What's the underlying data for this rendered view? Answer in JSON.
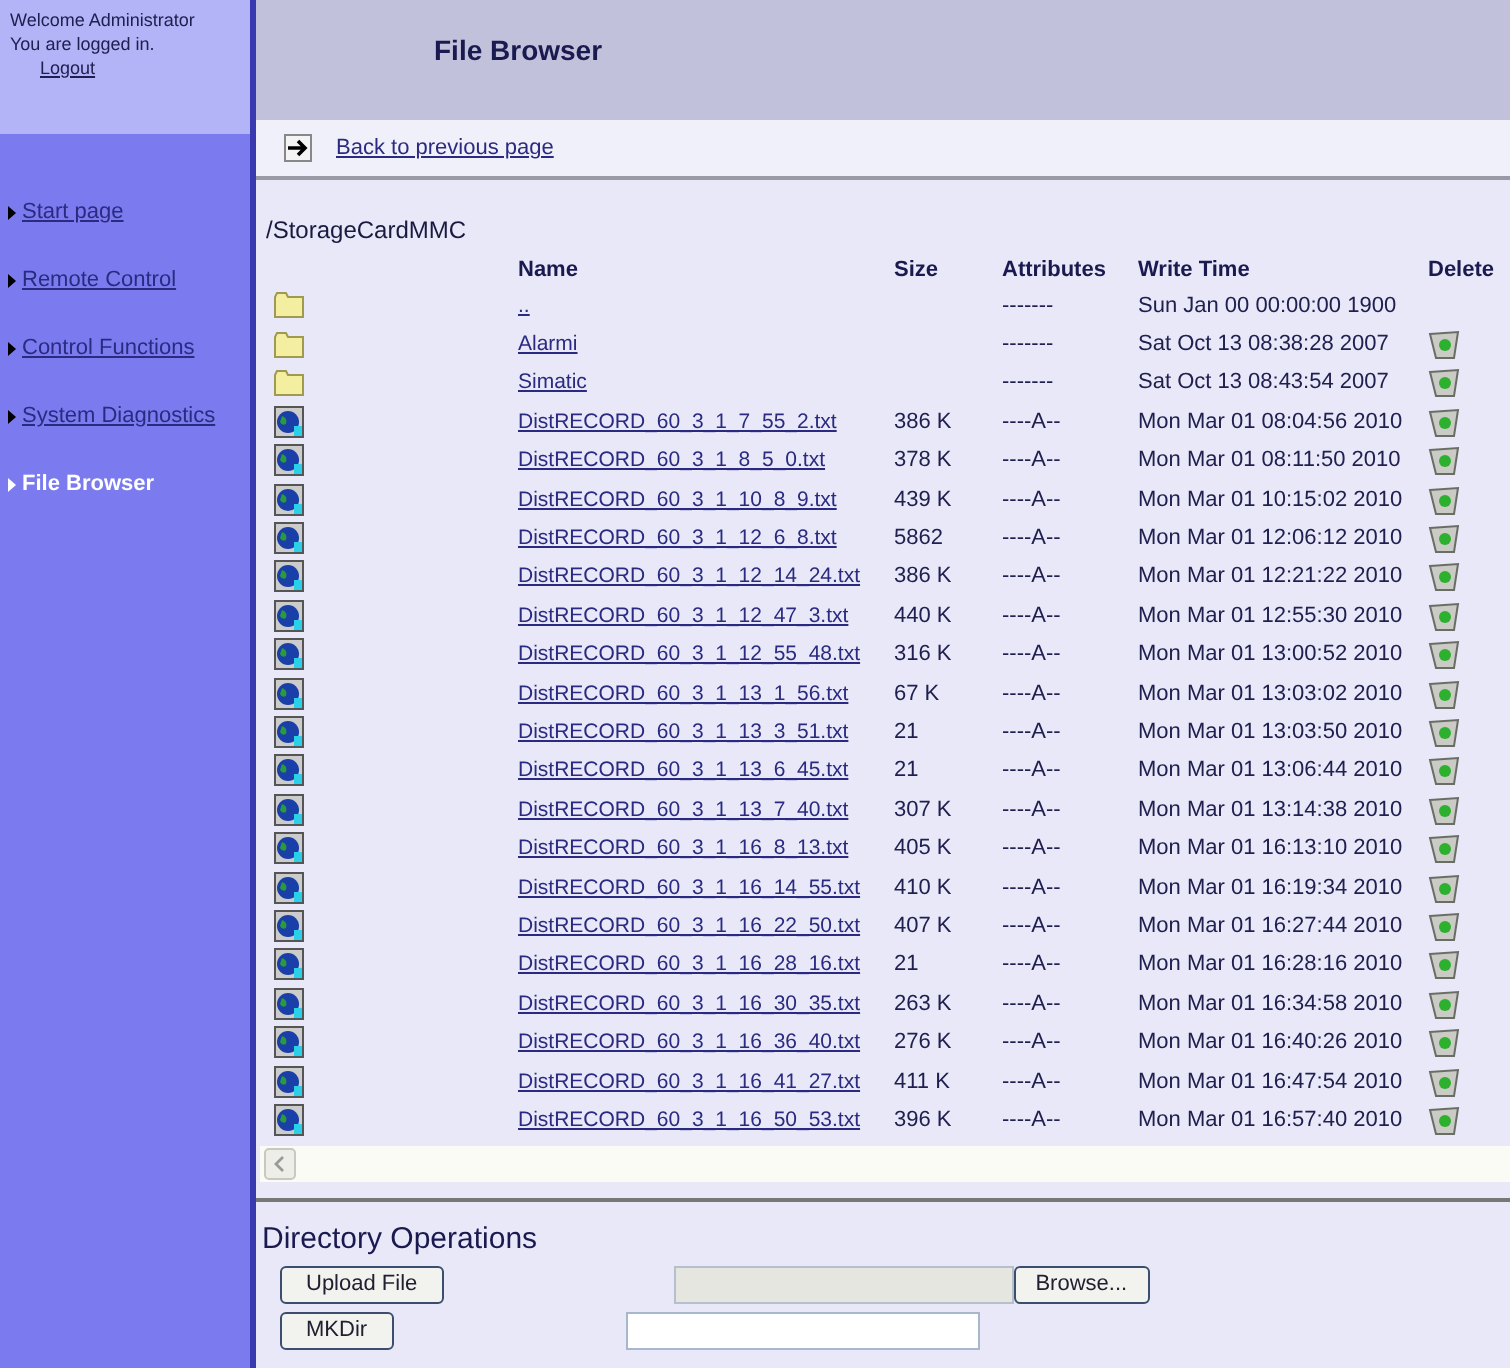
{
  "sidebar": {
    "welcome": [
      "Welcome Administrator",
      "You are logged in."
    ],
    "logout": "Logout",
    "items": [
      {
        "label": "Start page",
        "selected": false
      },
      {
        "label": "Remote Control",
        "selected": false
      },
      {
        "label": "Control Functions",
        "selected": false
      },
      {
        "label": "System Diagnostics",
        "selected": false
      },
      {
        "label": "File Browser",
        "selected": true
      }
    ]
  },
  "header": {
    "title": "File Browser"
  },
  "back_link": "Back to previous page",
  "path": "/StorageCardMMC",
  "table": {
    "columns": [
      "Name",
      "Size",
      "Attributes",
      "Write Time",
      "Delete"
    ],
    "rows": [
      {
        "kind": "folder",
        "name": "..",
        "size": "",
        "attributes": "-------",
        "time": "Sun Jan 00 00:00:00 1900",
        "deletable": false
      },
      {
        "kind": "folder",
        "name": "Alarmi",
        "size": "",
        "attributes": "-------",
        "time": "Sat Oct 13 08:38:28 2007",
        "deletable": true
      },
      {
        "kind": "folder",
        "name": "Simatic",
        "size": "",
        "attributes": "-------",
        "time": "Sat Oct 13 08:43:54 2007",
        "deletable": true
      },
      {
        "kind": "file",
        "name": "DistRECORD_60_3_1_7_55_2.txt",
        "size": "386 K",
        "attributes": "----A--",
        "time": "Mon Mar 01 08:04:56 2010",
        "deletable": true
      },
      {
        "kind": "file",
        "name": "DistRECORD_60_3_1_8_5_0.txt",
        "size": "378 K",
        "attributes": "----A--",
        "time": "Mon Mar 01 08:11:50 2010",
        "deletable": true
      },
      {
        "kind": "file",
        "name": "DistRECORD_60_3_1_10_8_9.txt",
        "size": "439 K",
        "attributes": "----A--",
        "time": "Mon Mar 01 10:15:02 2010",
        "deletable": true
      },
      {
        "kind": "file",
        "name": "DistRECORD_60_3_1_12_6_8.txt",
        "size": "5862",
        "attributes": "----A--",
        "time": "Mon Mar 01 12:06:12 2010",
        "deletable": true
      },
      {
        "kind": "file",
        "name": "DistRECORD_60_3_1_12_14_24.txt",
        "size": "386 K",
        "attributes": "----A--",
        "time": "Mon Mar 01 12:21:22 2010",
        "deletable": true
      },
      {
        "kind": "file",
        "name": "DistRECORD_60_3_1_12_47_3.txt",
        "size": "440 K",
        "attributes": "----A--",
        "time": "Mon Mar 01 12:55:30 2010",
        "deletable": true
      },
      {
        "kind": "file",
        "name": "DistRECORD_60_3_1_12_55_48.txt",
        "size": "316 K",
        "attributes": "----A--",
        "time": "Mon Mar 01 13:00:52 2010",
        "deletable": true
      },
      {
        "kind": "file",
        "name": "DistRECORD_60_3_1_13_1_56.txt",
        "size": "67 K",
        "attributes": "----A--",
        "time": "Mon Mar 01 13:03:02 2010",
        "deletable": true
      },
      {
        "kind": "file",
        "name": "DistRECORD_60_3_1_13_3_51.txt",
        "size": "21",
        "attributes": "----A--",
        "time": "Mon Mar 01 13:03:50 2010",
        "deletable": true
      },
      {
        "kind": "file",
        "name": "DistRECORD_60_3_1_13_6_45.txt",
        "size": "21",
        "attributes": "----A--",
        "time": "Mon Mar 01 13:06:44 2010",
        "deletable": true
      },
      {
        "kind": "file",
        "name": "DistRECORD_60_3_1_13_7_40.txt",
        "size": "307 K",
        "attributes": "----A--",
        "time": "Mon Mar 01 13:14:38 2010",
        "deletable": true
      },
      {
        "kind": "file",
        "name": "DistRECORD_60_3_1_16_8_13.txt",
        "size": "405 K",
        "attributes": "----A--",
        "time": "Mon Mar 01 16:13:10 2010",
        "deletable": true
      },
      {
        "kind": "file",
        "name": "DistRECORD_60_3_1_16_14_55.txt",
        "size": "410 K",
        "attributes": "----A--",
        "time": "Mon Mar 01 16:19:34 2010",
        "deletable": true
      },
      {
        "kind": "file",
        "name": "DistRECORD_60_3_1_16_22_50.txt",
        "size": "407 K",
        "attributes": "----A--",
        "time": "Mon Mar 01 16:27:44 2010",
        "deletable": true
      },
      {
        "kind": "file",
        "name": "DistRECORD_60_3_1_16_28_16.txt",
        "size": "21",
        "attributes": "----A--",
        "time": "Mon Mar 01 16:28:16 2010",
        "deletable": true
      },
      {
        "kind": "file",
        "name": "DistRECORD_60_3_1_16_30_35.txt",
        "size": "263 K",
        "attributes": "----A--",
        "time": "Mon Mar 01 16:34:58 2010",
        "deletable": true
      },
      {
        "kind": "file",
        "name": "DistRECORD_60_3_1_16_36_40.txt",
        "size": "276 K",
        "attributes": "----A--",
        "time": "Mon Mar 01 16:40:26 2010",
        "deletable": true
      },
      {
        "kind": "file",
        "name": "DistRECORD_60_3_1_16_41_27.txt",
        "size": "411 K",
        "attributes": "----A--",
        "time": "Mon Mar 01 16:47:54 2010",
        "deletable": true
      },
      {
        "kind": "file",
        "name": "DistRECORD_60_3_1_16_50_53.txt",
        "size": "396 K",
        "attributes": "----A--",
        "time": "Mon Mar 01 16:57:40 2010",
        "deletable": true
      }
    ]
  },
  "directory_operations": {
    "title": "Directory Operations",
    "upload_button": "Upload File",
    "browse_button": "Browse...",
    "mkdir_button": "MKDir"
  }
}
